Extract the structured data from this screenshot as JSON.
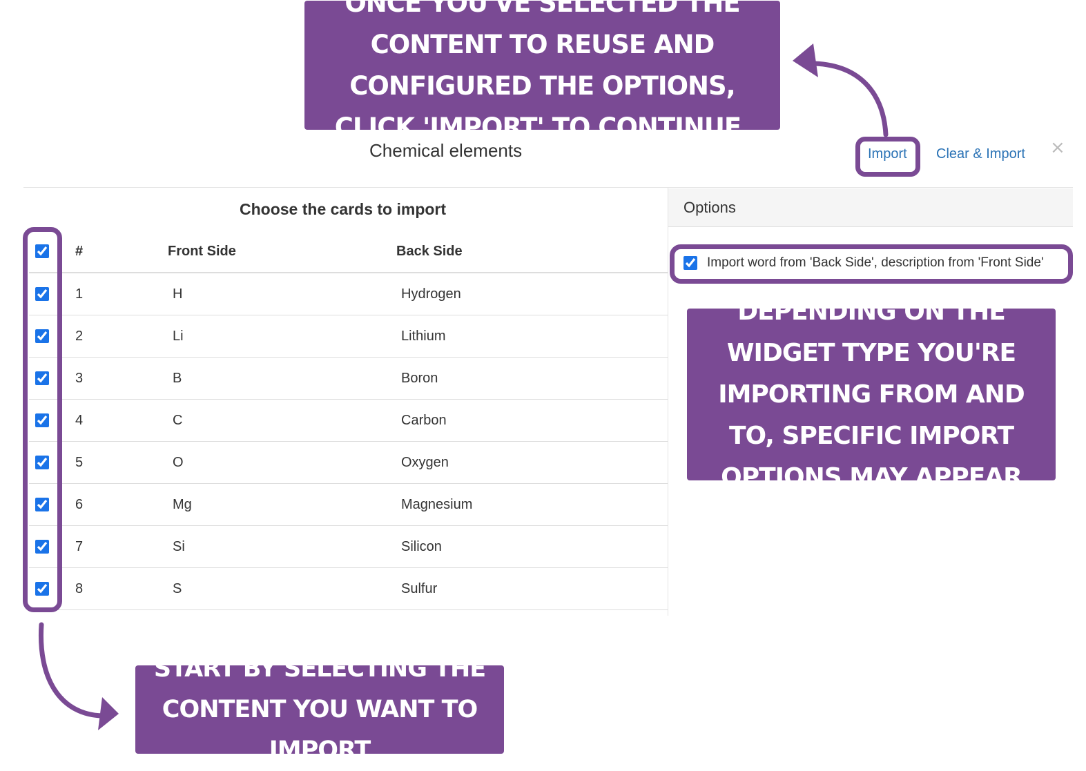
{
  "callouts": {
    "top": "Once you've selected the content to reuse and configured the options, click 'Import' to continue.",
    "right": "Depending on the widget type you're importing from and to, specific import options may appear",
    "bottom": "Start by selecting the content you want to import"
  },
  "header": {
    "title": "Chemical elements",
    "import_label": "Import",
    "clear_import_label": "Clear & Import",
    "close_label": "×"
  },
  "cards_pane": {
    "title": "Choose the cards to import",
    "columns": [
      "#",
      "Front Side",
      "Back Side"
    ],
    "select_all_checked": true,
    "rows": [
      {
        "num": "1",
        "front": "H",
        "back": "Hydrogen",
        "checked": true
      },
      {
        "num": "2",
        "front": "Li",
        "back": "Lithium",
        "checked": true
      },
      {
        "num": "3",
        "front": "B",
        "back": "Boron",
        "checked": true
      },
      {
        "num": "4",
        "front": "C",
        "back": "Carbon",
        "checked": true
      },
      {
        "num": "5",
        "front": "O",
        "back": "Oxygen",
        "checked": true
      },
      {
        "num": "6",
        "front": "Mg",
        "back": "Magnesium",
        "checked": true
      },
      {
        "num": "7",
        "front": "Si",
        "back": "Silicon",
        "checked": true
      },
      {
        "num": "8",
        "front": "S",
        "back": "Sulfur",
        "checked": true
      }
    ]
  },
  "options_pane": {
    "title": "Options",
    "options": [
      {
        "label": "Import word from 'Back Side', description from 'Front Side'",
        "checked": true
      }
    ]
  },
  "colors": {
    "callout": "#7a4a94",
    "link": "#2a72b5",
    "checkbox": "#1a73e8"
  }
}
